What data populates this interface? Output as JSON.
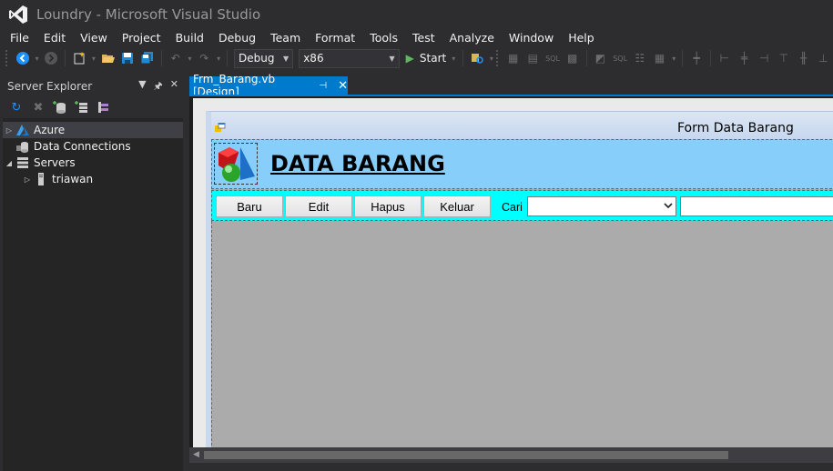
{
  "window": {
    "title": "Loundry - Microsoft Visual Studio"
  },
  "menu": [
    "File",
    "Edit",
    "View",
    "Project",
    "Build",
    "Debug",
    "Team",
    "Format",
    "Tools",
    "Test",
    "Analyze",
    "Window",
    "Help"
  ],
  "toolbar": {
    "config": "Debug",
    "platform": "x86",
    "start_label": "Start"
  },
  "server_explorer": {
    "title": "Server Explorer",
    "tree": [
      {
        "label": "Azure",
        "expanded": false,
        "icon": "azure-icon",
        "depth": 0
      },
      {
        "label": "Data Connections",
        "expanded": null,
        "icon": "data-connections-icon",
        "depth": 0
      },
      {
        "label": "Servers",
        "expanded": true,
        "icon": "servers-icon",
        "depth": 0
      },
      {
        "label": "triawan",
        "expanded": false,
        "icon": "server-icon",
        "depth": 1
      }
    ]
  },
  "document_tab": {
    "label": "Frm_Barang.vb [Design]"
  },
  "form": {
    "title": "Form Data Barang",
    "header": "DATA BARANG",
    "buttons": [
      "Baru",
      "Edit",
      "Hapus",
      "Keluar"
    ],
    "search_label": "Cari",
    "search_combo_value": "",
    "search_text_value": ""
  },
  "colors": {
    "accent": "#007acc",
    "header_panel": "#87cefa",
    "button_panel": "#00ffff",
    "grid_bg": "#ababab"
  }
}
